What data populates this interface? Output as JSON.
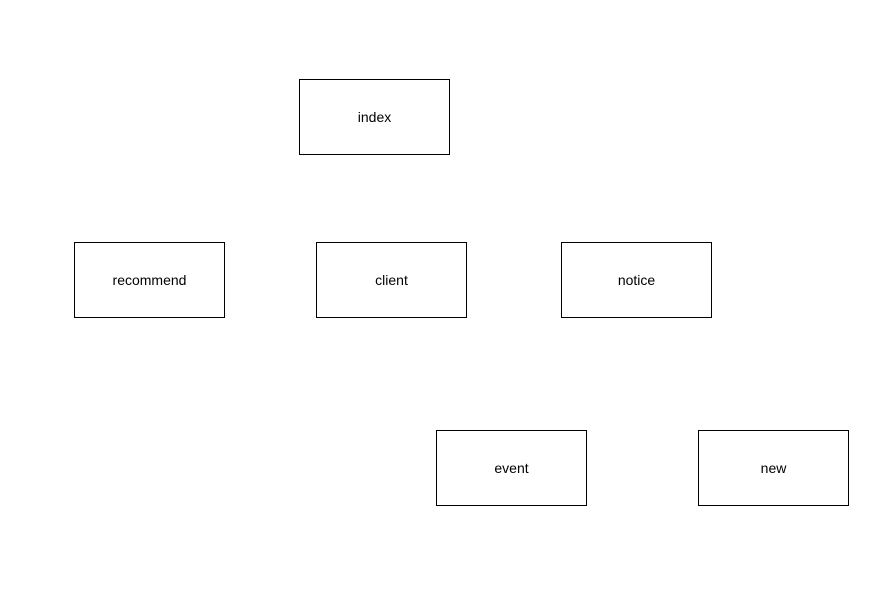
{
  "diagram": {
    "nodes": [
      {
        "id": "index",
        "label": "index"
      },
      {
        "id": "recommend",
        "label": "recommend"
      },
      {
        "id": "client",
        "label": "client"
      },
      {
        "id": "notice",
        "label": "notice"
      },
      {
        "id": "event",
        "label": "event"
      },
      {
        "id": "new",
        "label": "new"
      }
    ]
  }
}
